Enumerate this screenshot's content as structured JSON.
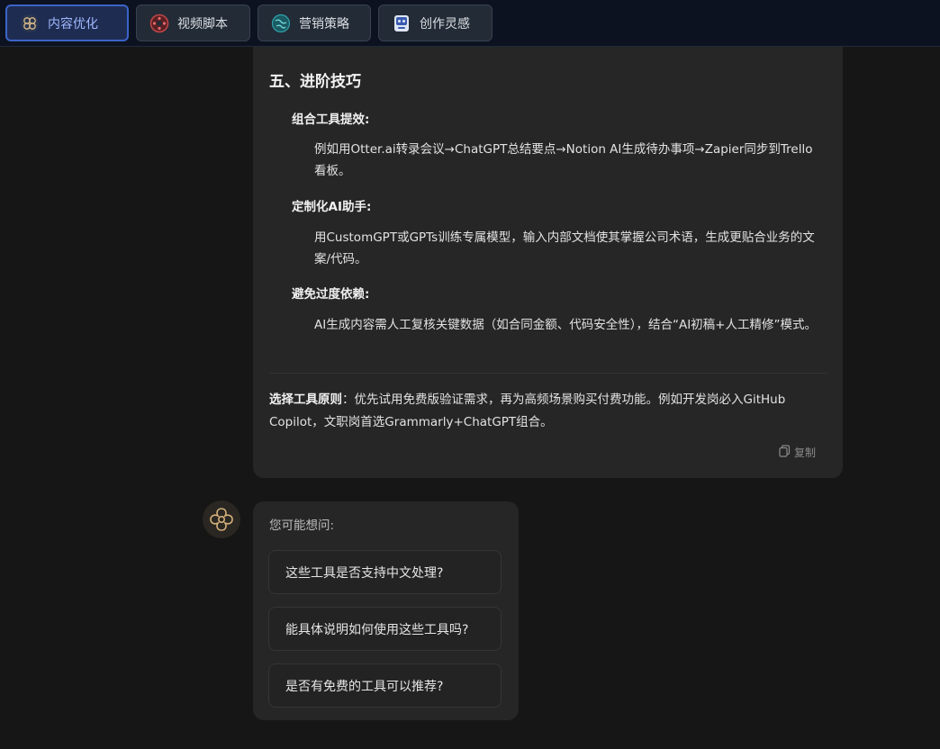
{
  "tabs": [
    {
      "label": "内容优化",
      "icon": "brain-icon",
      "active": true
    },
    {
      "label": "视频脚本",
      "icon": "film-reel-icon",
      "active": false
    },
    {
      "label": "营销策略",
      "icon": "globe-icon",
      "active": false
    },
    {
      "label": "创作灵感",
      "icon": "robot-icon",
      "active": false
    }
  ],
  "answer": {
    "section_title": "五、进阶技巧",
    "items": [
      {
        "title": "组合工具提效:",
        "body": "例如用Otter.ai转录会议→ChatGPT总结要点→Notion AI生成待办事项→Zapier同步到Trello看板。"
      },
      {
        "title": "定制化AI助手:",
        "body": "用CustomGPT或GPTs训练专属模型，输入内部文档使其掌握公司术语，生成更贴合业务的文案/代码。"
      },
      {
        "title": "避免过度依赖:",
        "body": "AI生成内容需人工复核关键数据（如合同金额、代码安全性），结合“AI初稿+人工精修”模式。"
      }
    ],
    "principle_label": "选择工具原则",
    "principle_text": "：优先试用免费版验证需求，再为高频场景购买付费功能。例如开发岗必入GitHub Copilot，文职岗首选Grammarly+ChatGPT组合。",
    "copy_label": "复制"
  },
  "suggestions": {
    "title": "您可能想问:",
    "questions": [
      "这些工具是否支持中文处理?",
      "能具体说明如何使用这些工具吗?",
      "是否有免费的工具可以推荐?"
    ]
  },
  "colors": {
    "background": "#161616",
    "card": "#262626",
    "topbar": "#0c1220",
    "active_tab_border": "#3b64c8",
    "active_tab_text": "#9fb9ff"
  }
}
